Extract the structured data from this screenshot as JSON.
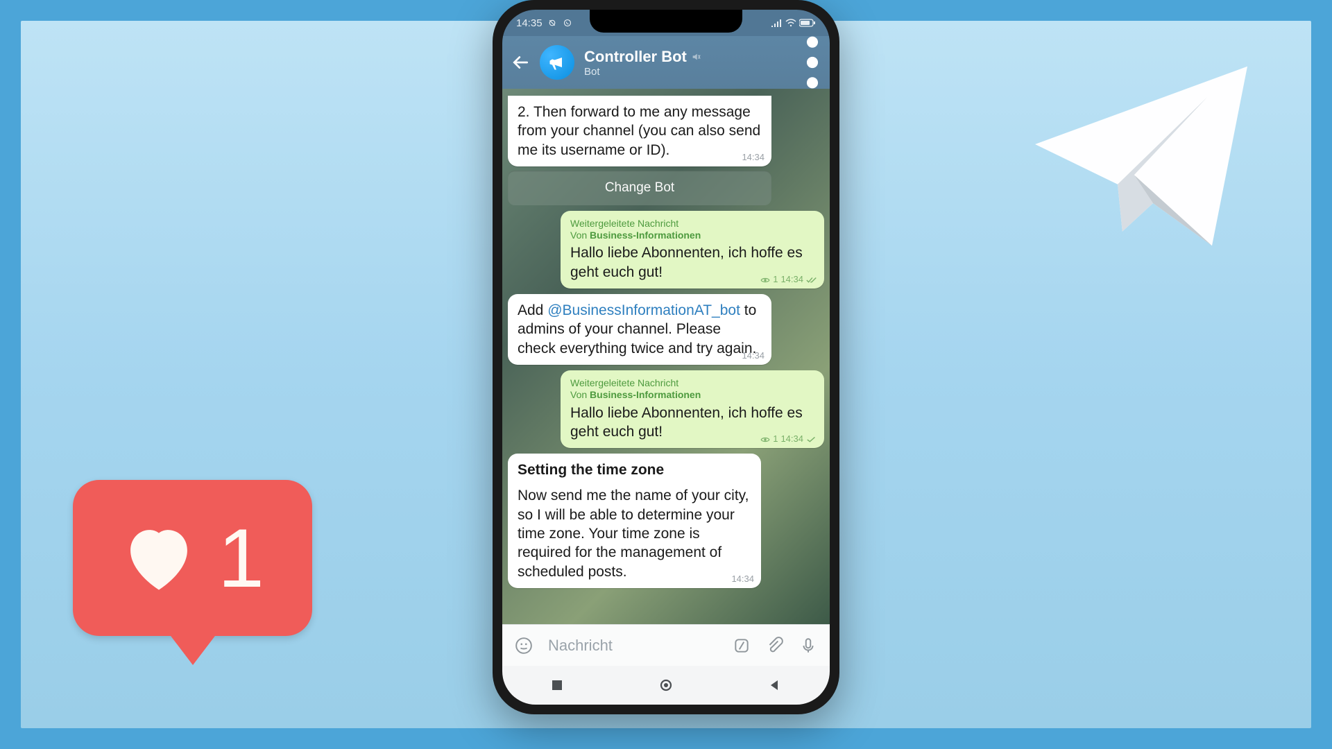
{
  "like": {
    "count": "1"
  },
  "statusbar": {
    "time": "14:35"
  },
  "header": {
    "title": "Controller Bot",
    "subtitle": "Bot"
  },
  "messages": {
    "m1_text": "2. Then forward to me any message from your channel (you can also send me its username or ID).",
    "m1_time": "14:34",
    "btn_change_bot": "Change Bot",
    "m2_fwd_label": "Weitergeleitete Nachricht",
    "m2_fwd_prefix": "Von ",
    "m2_fwd_from": "Business-Informationen",
    "m2_text": "Hallo liebe Abonnenten, ich hoffe es geht euch gut!",
    "m2_views": "1",
    "m2_time": "14:34",
    "m3_pre": "Add ",
    "m3_mention": "@BusinessInformationAT_bot",
    "m3_post": " to admins of your channel. Please check everything twice and try again.",
    "m3_time": "14:34",
    "m4_fwd_label": "Weitergeleitete Nachricht",
    "m4_fwd_prefix": "Von ",
    "m4_fwd_from": "Business-Informationen",
    "m4_text": "Hallo liebe Abonnenten, ich hoffe es geht euch gut!",
    "m4_views": "1",
    "m4_time": "14:34",
    "m5_title": "Setting the time zone",
    "m5_text": "Now send me the name of your city, so I will be able to determine your time zone. Your time zone is required for the management of scheduled posts.",
    "m5_time": "14:34"
  },
  "input": {
    "placeholder": "Nachricht"
  }
}
